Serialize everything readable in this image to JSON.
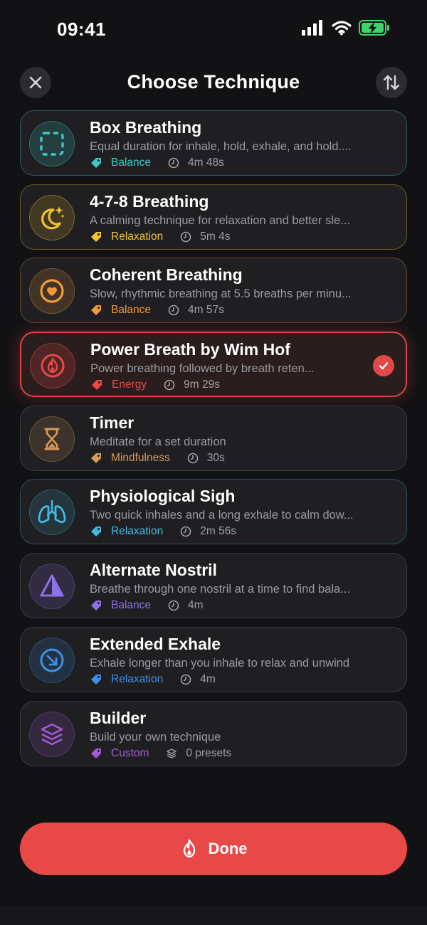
{
  "status": {
    "time": "09:41"
  },
  "header": {
    "title": "Choose Technique"
  },
  "techniques": [
    {
      "title": "Box Breathing",
      "description": "Equal duration for inhale, hold, exhale, and hold....",
      "category": "Balance",
      "duration": "4m 48s",
      "color": "#3ec7c7",
      "icon": "square-dashed-icon",
      "selected": false
    },
    {
      "title": "4-7-8 Breathing",
      "description": "A calming technique for relaxation and better sle...",
      "category": "Relaxation",
      "duration": "5m 4s",
      "color": "#f2c230",
      "icon": "moon-stars-icon",
      "selected": false
    },
    {
      "title": "Coherent Breathing",
      "description": "Slow, rhythmic breathing at 5.5 breaths per minu...",
      "category": "Balance",
      "duration": "4m 57s",
      "color": "#f29a3c",
      "icon": "heart-icon",
      "selected": false
    },
    {
      "title": "Power Breath by Wim Hof",
      "description": "Power breathing followed by breath reten...",
      "category": "Energy",
      "duration": "9m 29s",
      "color": "#e84848",
      "icon": "flame-icon",
      "selected": true
    },
    {
      "title": "Timer",
      "description": "Meditate for a set duration",
      "category": "Mindfulness",
      "duration": "30s",
      "color": "#d79a5a",
      "icon": "hourglass-icon",
      "selected": false
    },
    {
      "title": "Physiological Sigh",
      "description": "Two quick inhales and a long exhale to calm dow...",
      "category": "Relaxation",
      "duration": "2m 56s",
      "color": "#43b8e0",
      "icon": "lungs-icon",
      "selected": false
    },
    {
      "title": "Alternate Nostril",
      "description": "Breathe through one nostril at a time to find bala...",
      "category": "Balance",
      "duration": "4m",
      "color": "#8c72e6",
      "icon": "triangle-half-icon",
      "selected": false
    },
    {
      "title": "Extended Exhale",
      "description": "Exhale longer than you inhale to relax and unwind",
      "category": "Relaxation",
      "duration": "4m",
      "color": "#3f8fe6",
      "icon": "arrow-down-right-icon",
      "selected": false
    },
    {
      "title": "Builder",
      "description": "Build your own technique",
      "category": "Custom",
      "duration": "0 presets",
      "color": "#a35ad8",
      "icon": "layers-icon",
      "selected": false
    }
  ],
  "done_button": {
    "label": "Done"
  }
}
